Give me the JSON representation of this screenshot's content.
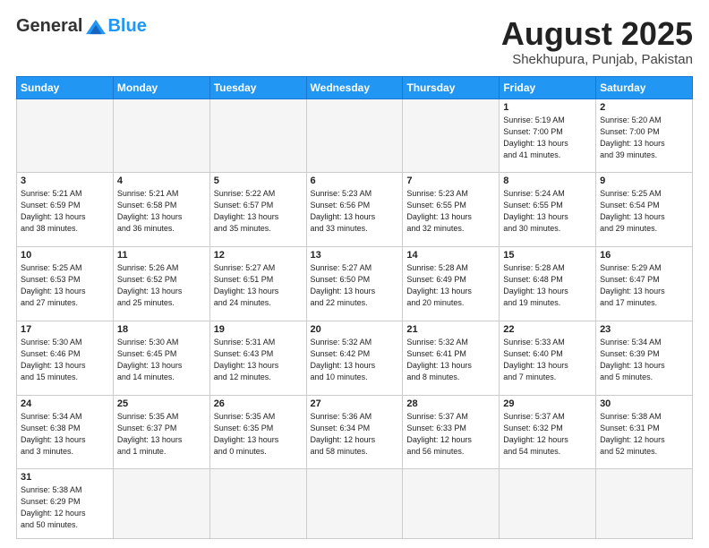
{
  "header": {
    "logo_general": "General",
    "logo_blue": "Blue",
    "month_title": "August 2025",
    "location": "Shekhupura, Punjab, Pakistan"
  },
  "days_of_week": [
    "Sunday",
    "Monday",
    "Tuesday",
    "Wednesday",
    "Thursday",
    "Friday",
    "Saturday"
  ],
  "weeks": [
    [
      {
        "day": "",
        "info": ""
      },
      {
        "day": "",
        "info": ""
      },
      {
        "day": "",
        "info": ""
      },
      {
        "day": "",
        "info": ""
      },
      {
        "day": "",
        "info": ""
      },
      {
        "day": "1",
        "info": "Sunrise: 5:19 AM\nSunset: 7:00 PM\nDaylight: 13 hours\nand 41 minutes."
      },
      {
        "day": "2",
        "info": "Sunrise: 5:20 AM\nSunset: 7:00 PM\nDaylight: 13 hours\nand 39 minutes."
      }
    ],
    [
      {
        "day": "3",
        "info": "Sunrise: 5:21 AM\nSunset: 6:59 PM\nDaylight: 13 hours\nand 38 minutes."
      },
      {
        "day": "4",
        "info": "Sunrise: 5:21 AM\nSunset: 6:58 PM\nDaylight: 13 hours\nand 36 minutes."
      },
      {
        "day": "5",
        "info": "Sunrise: 5:22 AM\nSunset: 6:57 PM\nDaylight: 13 hours\nand 35 minutes."
      },
      {
        "day": "6",
        "info": "Sunrise: 5:23 AM\nSunset: 6:56 PM\nDaylight: 13 hours\nand 33 minutes."
      },
      {
        "day": "7",
        "info": "Sunrise: 5:23 AM\nSunset: 6:55 PM\nDaylight: 13 hours\nand 32 minutes."
      },
      {
        "day": "8",
        "info": "Sunrise: 5:24 AM\nSunset: 6:55 PM\nDaylight: 13 hours\nand 30 minutes."
      },
      {
        "day": "9",
        "info": "Sunrise: 5:25 AM\nSunset: 6:54 PM\nDaylight: 13 hours\nand 29 minutes."
      }
    ],
    [
      {
        "day": "10",
        "info": "Sunrise: 5:25 AM\nSunset: 6:53 PM\nDaylight: 13 hours\nand 27 minutes."
      },
      {
        "day": "11",
        "info": "Sunrise: 5:26 AM\nSunset: 6:52 PM\nDaylight: 13 hours\nand 25 minutes."
      },
      {
        "day": "12",
        "info": "Sunrise: 5:27 AM\nSunset: 6:51 PM\nDaylight: 13 hours\nand 24 minutes."
      },
      {
        "day": "13",
        "info": "Sunrise: 5:27 AM\nSunset: 6:50 PM\nDaylight: 13 hours\nand 22 minutes."
      },
      {
        "day": "14",
        "info": "Sunrise: 5:28 AM\nSunset: 6:49 PM\nDaylight: 13 hours\nand 20 minutes."
      },
      {
        "day": "15",
        "info": "Sunrise: 5:28 AM\nSunset: 6:48 PM\nDaylight: 13 hours\nand 19 minutes."
      },
      {
        "day": "16",
        "info": "Sunrise: 5:29 AM\nSunset: 6:47 PM\nDaylight: 13 hours\nand 17 minutes."
      }
    ],
    [
      {
        "day": "17",
        "info": "Sunrise: 5:30 AM\nSunset: 6:46 PM\nDaylight: 13 hours\nand 15 minutes."
      },
      {
        "day": "18",
        "info": "Sunrise: 5:30 AM\nSunset: 6:45 PM\nDaylight: 13 hours\nand 14 minutes."
      },
      {
        "day": "19",
        "info": "Sunrise: 5:31 AM\nSunset: 6:43 PM\nDaylight: 13 hours\nand 12 minutes."
      },
      {
        "day": "20",
        "info": "Sunrise: 5:32 AM\nSunset: 6:42 PM\nDaylight: 13 hours\nand 10 minutes."
      },
      {
        "day": "21",
        "info": "Sunrise: 5:32 AM\nSunset: 6:41 PM\nDaylight: 13 hours\nand 8 minutes."
      },
      {
        "day": "22",
        "info": "Sunrise: 5:33 AM\nSunset: 6:40 PM\nDaylight: 13 hours\nand 7 minutes."
      },
      {
        "day": "23",
        "info": "Sunrise: 5:34 AM\nSunset: 6:39 PM\nDaylight: 13 hours\nand 5 minutes."
      }
    ],
    [
      {
        "day": "24",
        "info": "Sunrise: 5:34 AM\nSunset: 6:38 PM\nDaylight: 13 hours\nand 3 minutes."
      },
      {
        "day": "25",
        "info": "Sunrise: 5:35 AM\nSunset: 6:37 PM\nDaylight: 13 hours\nand 1 minute."
      },
      {
        "day": "26",
        "info": "Sunrise: 5:35 AM\nSunset: 6:35 PM\nDaylight: 13 hours\nand 0 minutes."
      },
      {
        "day": "27",
        "info": "Sunrise: 5:36 AM\nSunset: 6:34 PM\nDaylight: 12 hours\nand 58 minutes."
      },
      {
        "day": "28",
        "info": "Sunrise: 5:37 AM\nSunset: 6:33 PM\nDaylight: 12 hours\nand 56 minutes."
      },
      {
        "day": "29",
        "info": "Sunrise: 5:37 AM\nSunset: 6:32 PM\nDaylight: 12 hours\nand 54 minutes."
      },
      {
        "day": "30",
        "info": "Sunrise: 5:38 AM\nSunset: 6:31 PM\nDaylight: 12 hours\nand 52 minutes."
      }
    ],
    [
      {
        "day": "31",
        "info": "Sunrise: 5:38 AM\nSunset: 6:29 PM\nDaylight: 12 hours\nand 50 minutes."
      },
      {
        "day": "",
        "info": ""
      },
      {
        "day": "",
        "info": ""
      },
      {
        "day": "",
        "info": ""
      },
      {
        "day": "",
        "info": ""
      },
      {
        "day": "",
        "info": ""
      },
      {
        "day": "",
        "info": ""
      }
    ]
  ]
}
